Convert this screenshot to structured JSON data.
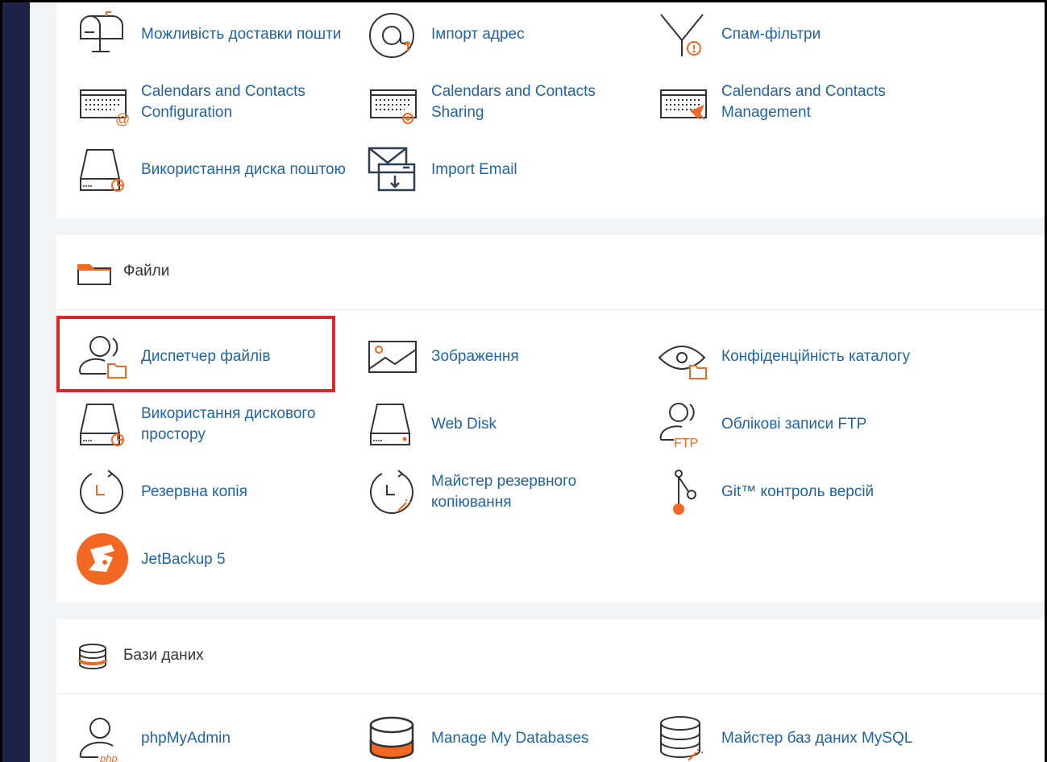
{
  "colors": {
    "sidebar": "#1d2348",
    "link": "#1f64a8",
    "accent": "#f26722",
    "highlight": "#e3252b"
  },
  "sections": {
    "email": {
      "items": [
        {
          "label": "Можливість доставки пошти",
          "icon": "mailbox-icon"
        },
        {
          "label": "Імпорт адрес",
          "icon": "at-import-icon"
        },
        {
          "label": "Спам-фільтри",
          "icon": "spam-filter-icon"
        },
        {
          "label": "Calendars and Contacts Configuration",
          "icon": "calendar-config-icon"
        },
        {
          "label": "Calendars and Contacts Sharing",
          "icon": "calendar-sharing-icon"
        },
        {
          "label": "Calendars and Contacts Management",
          "icon": "calendar-management-icon"
        },
        {
          "label": "Використання диска поштою",
          "icon": "disk-usage-icon"
        },
        {
          "label": "Import Email",
          "icon": "import-email-icon"
        }
      ]
    },
    "files": {
      "title": "Файли",
      "icon": "folder-icon",
      "items": [
        {
          "label": "Диспетчер файлів",
          "icon": "file-manager-icon"
        },
        {
          "label": "Зображення",
          "icon": "images-icon"
        },
        {
          "label": "Конфіденційність каталогу",
          "icon": "directory-privacy-icon"
        },
        {
          "label": "Використання дискового простору",
          "icon": "disk-usage-icon"
        },
        {
          "label": "Web Disk",
          "icon": "web-disk-icon"
        },
        {
          "label": "Облікові записи FTP",
          "icon": "ftp-accounts-icon"
        },
        {
          "label": "Резервна копія",
          "icon": "backup-icon"
        },
        {
          "label": "Майстер резервного копіювання",
          "icon": "backup-wizard-icon"
        },
        {
          "label": "Git™ контроль версій",
          "icon": "git-icon"
        },
        {
          "label": "JetBackup 5",
          "icon": "jetbackup-icon"
        }
      ]
    },
    "databases": {
      "title": "Бази даних",
      "icon": "database-icon",
      "items": [
        {
          "label": "phpMyAdmin",
          "icon": "phpmyadmin-icon"
        },
        {
          "label": "Manage My Databases",
          "icon": "manage-databases-icon"
        },
        {
          "label": "Майстер баз даних MySQL",
          "icon": "mysql-wizard-icon"
        }
      ]
    }
  }
}
